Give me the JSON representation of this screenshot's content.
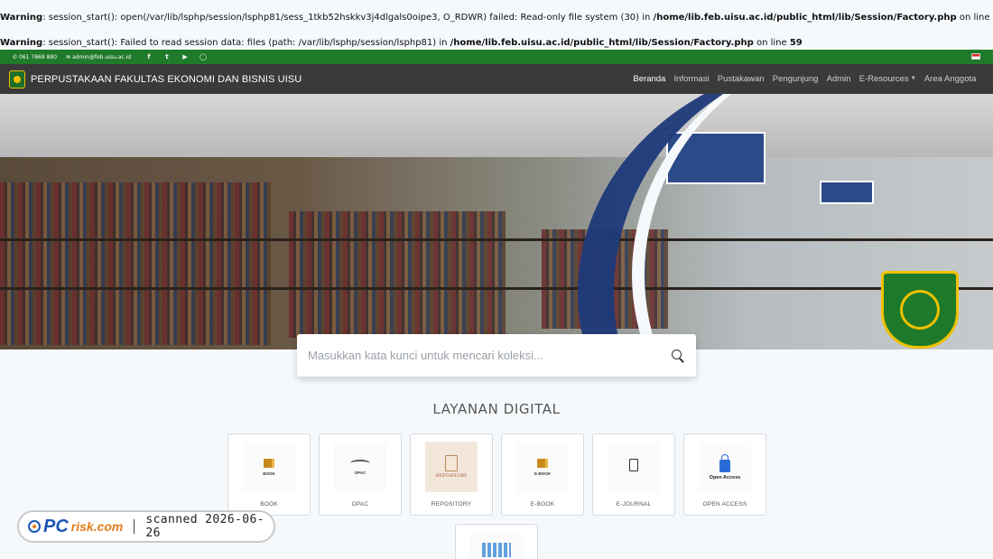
{
  "warnings": [
    {
      "label": "Warning",
      "text_before": ": session_start(): open(/var/lib/lsphp/session/lsphp81/sess_1tkb52hskkv3j4dlgals0oipe3, O_RDWR) failed: Read-only file system (30) in ",
      "path": "/home/lib.feb.uisu.ac.id/public_html/lib/Session/Factory.php",
      "line_text": " on line ",
      "line": "59"
    },
    {
      "label": "Warning",
      "text_before": ": session_start(): Failed to read session data: files (path: /var/lib/lsphp/session/lsphp81) in ",
      "path": "/home/lib.feb.uisu.ac.id/public_html/lib/Session/Factory.php",
      "line_text": " on line ",
      "line": "59"
    }
  ],
  "topbar": {
    "phone": "061 7869 880",
    "email": "admin@feb.uisu.ac.id",
    "social": [
      "facebook-icon",
      "twitter-icon",
      "youtube-icon",
      "instagram-icon"
    ]
  },
  "navbar": {
    "brand": "PERPUSTAKAAN FAKULTAS EKONOMI DAN BISNIS UISU",
    "links": [
      "Beranda",
      "Informasi",
      "Pustakawan",
      "Pengunjung",
      "Admin",
      "E-Resources",
      "Area Anggota"
    ],
    "active": "Beranda"
  },
  "search": {
    "placeholder": "Masukkan kata kunci untuk mencari koleksi..."
  },
  "section": {
    "title": "LAYANAN DIGITAL"
  },
  "services": [
    {
      "label": "BOOK",
      "caption": "BOOK"
    },
    {
      "label": "OPAC",
      "caption": "OPAC"
    },
    {
      "label": "REPOSITORY",
      "caption": "REPOSITORY"
    },
    {
      "label": "E-BOOK",
      "caption": "E-BOOK"
    },
    {
      "label": "E-JOURNAL",
      "caption": ""
    },
    {
      "label": "OPEN ACCESS",
      "caption": "Open Access"
    }
  ],
  "watermark": {
    "brand_pc": "PC",
    "brand_risk": "risk.com",
    "scanned": "scanned 2026-06-26"
  },
  "colors": {
    "topbar": "#1f7a2a",
    "navbar": "#3a3a3a",
    "hero_curve": "#1e3a7a"
  }
}
